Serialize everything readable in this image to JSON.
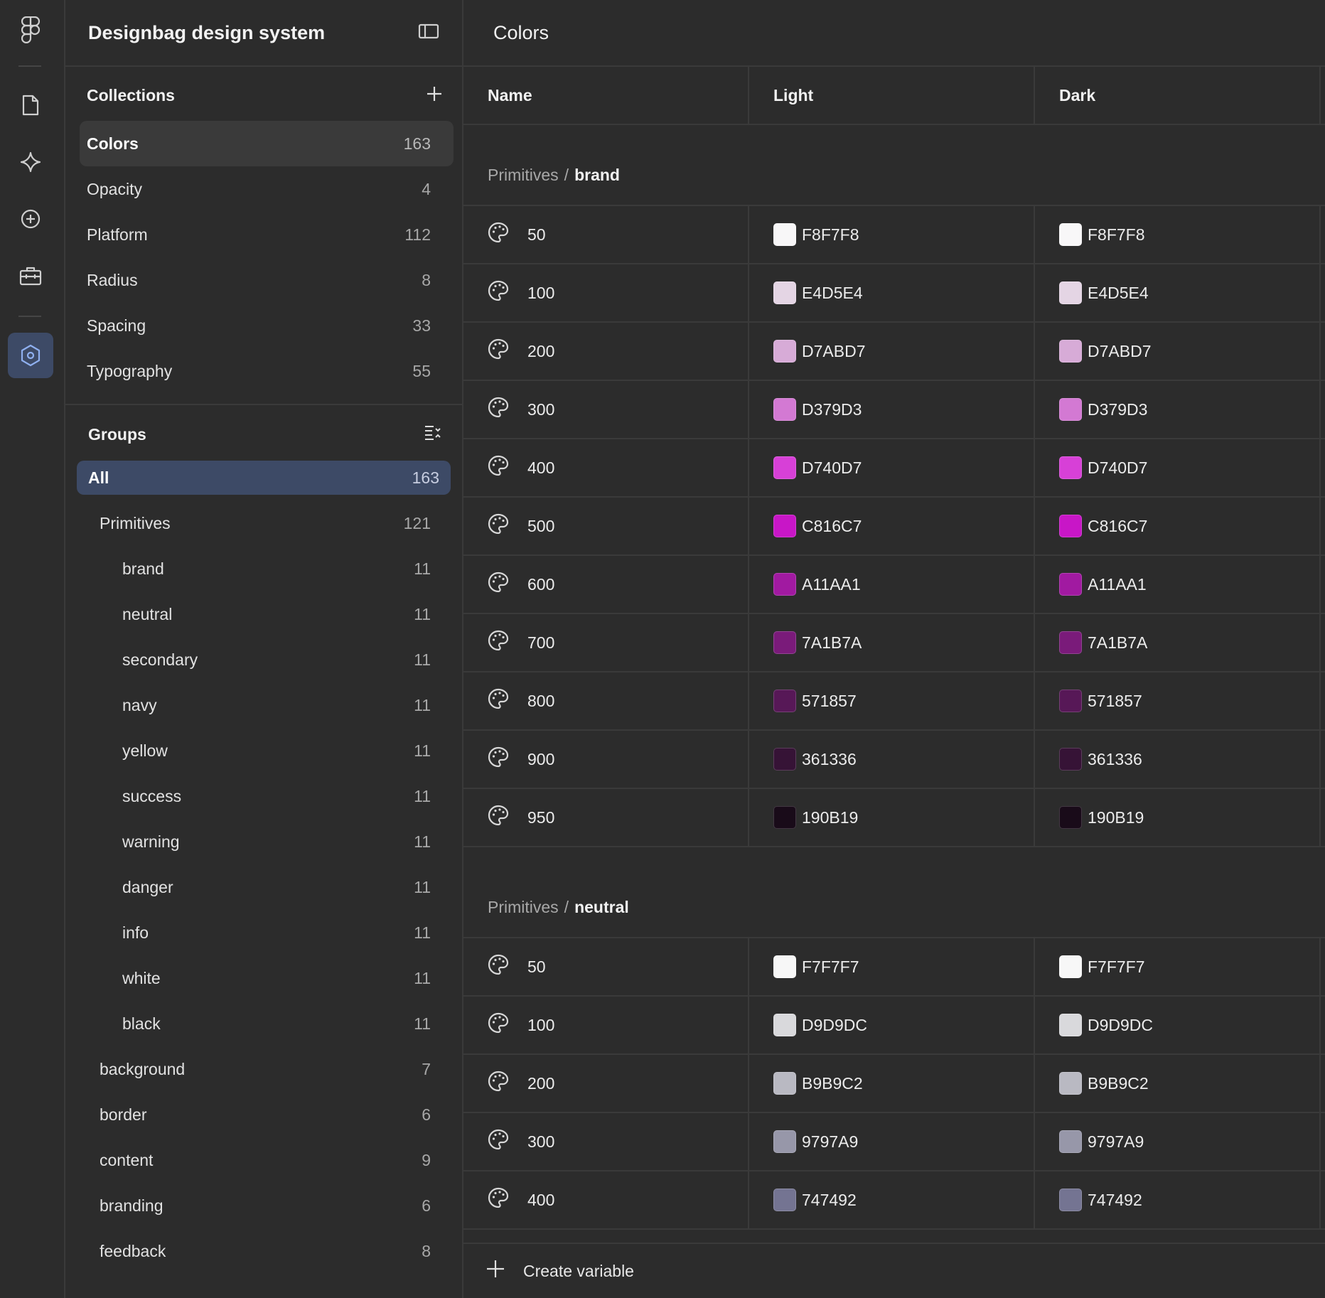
{
  "rail": {
    "icons": [
      "figma-logo-icon",
      "file-icon",
      "sparkle-icon",
      "add-circle-icon",
      "toolbox-icon",
      "variables-icon"
    ]
  },
  "panel": {
    "title": "Designbag design system",
    "collections_title": "Collections",
    "collections": [
      {
        "label": "Colors",
        "count": "163"
      },
      {
        "label": "Opacity",
        "count": "4"
      },
      {
        "label": "Platform",
        "count": "112"
      },
      {
        "label": "Radius",
        "count": "8"
      },
      {
        "label": "Spacing",
        "count": "33"
      },
      {
        "label": "Typography",
        "count": "55"
      }
    ],
    "groups_title": "Groups",
    "groups": [
      {
        "label": "All",
        "count": "163"
      },
      {
        "label": "Primitives",
        "count": "121"
      },
      {
        "label": "brand",
        "count": "11"
      },
      {
        "label": "neutral",
        "count": "11"
      },
      {
        "label": "secondary",
        "count": "11"
      },
      {
        "label": "navy",
        "count": "11"
      },
      {
        "label": "yellow",
        "count": "11"
      },
      {
        "label": "success",
        "count": "11"
      },
      {
        "label": "warning",
        "count": "11"
      },
      {
        "label": "danger",
        "count": "11"
      },
      {
        "label": "info",
        "count": "11"
      },
      {
        "label": "white",
        "count": "11"
      },
      {
        "label": "black",
        "count": "11"
      },
      {
        "label": "background",
        "count": "7"
      },
      {
        "label": "border",
        "count": "6"
      },
      {
        "label": "content",
        "count": "9"
      },
      {
        "label": "branding",
        "count": "6"
      },
      {
        "label": "feedback",
        "count": "8"
      }
    ]
  },
  "main": {
    "title": "Colors",
    "columns": [
      "Name",
      "Light",
      "Dark"
    ],
    "sections": [
      {
        "prefix": "Primitives",
        "group": "brand",
        "rows": [
          {
            "name": "50",
            "light": "F8F7F8",
            "dark": "F8F7F8",
            "color": "#F8F7F8"
          },
          {
            "name": "100",
            "light": "E4D5E4",
            "dark": "E4D5E4",
            "color": "#E4D5E4"
          },
          {
            "name": "200",
            "light": "D7ABD7",
            "dark": "D7ABD7",
            "color": "#D7ABD7"
          },
          {
            "name": "300",
            "light": "D379D3",
            "dark": "D379D3",
            "color": "#D379D3"
          },
          {
            "name": "400",
            "light": "D740D7",
            "dark": "D740D7",
            "color": "#D740D7"
          },
          {
            "name": "500",
            "light": "C816C7",
            "dark": "C816C7",
            "color": "#C816C7"
          },
          {
            "name": "600",
            "light": "A11AA1",
            "dark": "A11AA1",
            "color": "#A11AA1"
          },
          {
            "name": "700",
            "light": "7A1B7A",
            "dark": "7A1B7A",
            "color": "#7A1B7A"
          },
          {
            "name": "800",
            "light": "571857",
            "dark": "571857",
            "color": "#571857"
          },
          {
            "name": "900",
            "light": "361336",
            "dark": "361336",
            "color": "#361336"
          },
          {
            "name": "950",
            "light": "190B19",
            "dark": "190B19",
            "color": "#190B19"
          }
        ]
      },
      {
        "prefix": "Primitives",
        "group": "neutral",
        "rows": [
          {
            "name": "50",
            "light": "F7F7F7",
            "dark": "F7F7F7",
            "color": "#F7F7F7"
          },
          {
            "name": "100",
            "light": "D9D9DC",
            "dark": "D9D9DC",
            "color": "#D9D9DC"
          },
          {
            "name": "200",
            "light": "B9B9C2",
            "dark": "B9B9C2",
            "color": "#B9B9C2"
          },
          {
            "name": "300",
            "light": "9797A9",
            "dark": "9797A9",
            "color": "#9797A9"
          },
          {
            "name": "400",
            "light": "747492",
            "dark": "747492",
            "color": "#747492"
          }
        ]
      }
    ],
    "create_label": "Create variable"
  }
}
